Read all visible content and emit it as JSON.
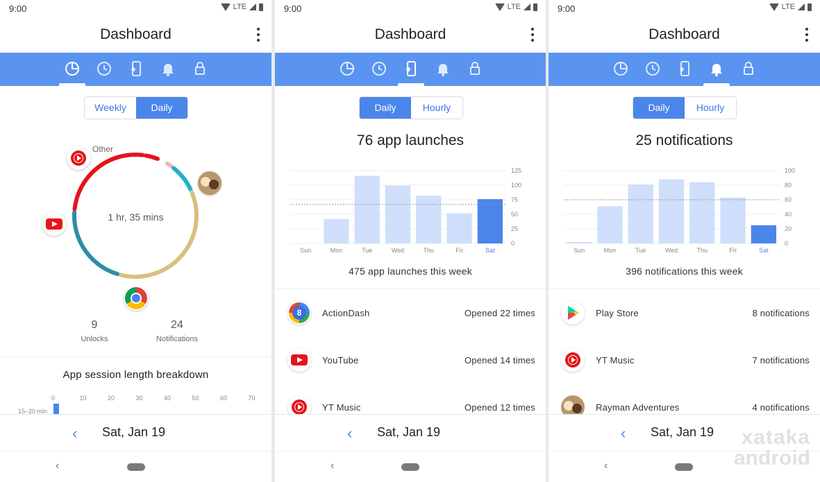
{
  "status": {
    "time": "9:00",
    "network": "LTE"
  },
  "colors": {
    "accent": "#5a94f0",
    "bar_light": "#cfdffb",
    "bar_selected": "#4a86ea"
  },
  "tab_icons": [
    "pie-chart-icon",
    "clock-icon",
    "phone-tap-icon",
    "bell-icon",
    "lock-icon"
  ],
  "panels": [
    {
      "title": "Dashboard",
      "toggle": {
        "left": "Weekly",
        "right": "Daily",
        "selected": "right"
      },
      "ring_center": "1 hr, 35 mins",
      "ring_label_other": "Other",
      "ring_segments": [
        {
          "app": "Other",
          "color": "#f2b6b9",
          "fraction": 0.02
        },
        {
          "app": "Other-teal",
          "color": "#1fb1c6",
          "fraction": 0.08
        },
        {
          "app": "Rayman Adventures",
          "color": "#d8c07f",
          "fraction": 0.36
        },
        {
          "app": "Chrome",
          "color": "#2e8da6",
          "fraction": 0.22
        },
        {
          "app": "YouTube",
          "color": "#e6141b",
          "fraction": 0.26
        },
        {
          "app": "YT Music",
          "color": "#e6141b",
          "fraction": 0.04
        }
      ],
      "stats": [
        {
          "value": "9",
          "label": "Unlocks"
        },
        {
          "value": "24",
          "label": "Notifications"
        }
      ],
      "session_title": "App session length breakdown",
      "session_axis": [
        "0",
        "10",
        "20",
        "30",
        "40",
        "50",
        "60",
        "70"
      ],
      "session_row_label": "15–20 min",
      "date": "Sat, Jan 19"
    },
    {
      "title": "Dashboard",
      "toggle": {
        "left": "Daily",
        "right": "Hourly",
        "selected": "left"
      },
      "headline": "76 app launches",
      "weekly": "475 app launches this week",
      "items": [
        {
          "name": "ActionDash",
          "count": "Opened 22 times",
          "icon": "actiondash-icon"
        },
        {
          "name": "YouTube",
          "count": "Opened 14 times",
          "icon": "youtube-icon"
        },
        {
          "name": "YT Music",
          "count": "Opened 12 times",
          "icon": "yt-music-icon"
        }
      ],
      "date": "Sat, Jan 19"
    },
    {
      "title": "Dashboard",
      "toggle": {
        "left": "Daily",
        "right": "Hourly",
        "selected": "left"
      },
      "headline": "25 notifications",
      "weekly": "396 notifications this week",
      "items": [
        {
          "name": "Play Store",
          "count": "8 notifications",
          "icon": "play-store-icon"
        },
        {
          "name": "YT Music",
          "count": "7 notifications",
          "icon": "yt-music-icon"
        },
        {
          "name": "Rayman Adventures",
          "count": "4 notifications",
          "icon": "rayman-icon"
        }
      ],
      "date": "Sat, Jan 19"
    }
  ],
  "chart_data": [
    {
      "type": "bar",
      "categories": [
        "Sun",
        "Mon",
        "Tue",
        "Wed",
        "Thu",
        "Fri",
        "Sat"
      ],
      "values": [
        0,
        42,
        116,
        99,
        82,
        52,
        76
      ],
      "selected": "Sat",
      "y_ticks": [
        "125",
        "100",
        "75",
        "50",
        "25",
        "0"
      ],
      "ylim": [
        0,
        125
      ],
      "average": 67
    },
    {
      "type": "bar",
      "categories": [
        "Sun",
        "Mon",
        "Tue",
        "Wed",
        "Thu",
        "Fri",
        "Sat"
      ],
      "values": [
        2,
        51,
        81,
        88,
        84,
        63,
        25
      ],
      "selected": "Sat",
      "y_ticks": [
        "100",
        "80",
        "60",
        "40",
        "20",
        "0"
      ],
      "ylim": [
        0,
        100
      ],
      "average": 60
    }
  ],
  "watermark": {
    "line1": "xataka",
    "line2": "android"
  }
}
